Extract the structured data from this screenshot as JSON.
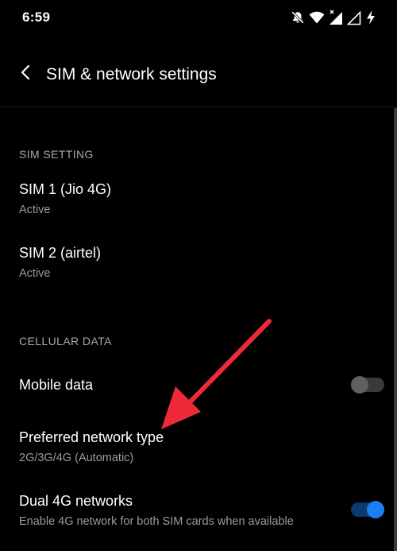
{
  "status_bar": {
    "time": "6:59",
    "icons": [
      "mute-bell-icon",
      "wifi-icon",
      "cell-signal-no-data-icon",
      "cell-signal-icon",
      "battery-charging-icon"
    ]
  },
  "header": {
    "back_icon": "back-chevron-icon",
    "title": "SIM & network settings"
  },
  "sections": {
    "sim": {
      "header": "SIM SETTING",
      "items": [
        {
          "title": "SIM 1  (Jio 4G)",
          "subtitle": "Active"
        },
        {
          "title": "SIM 2  (airtel)",
          "subtitle": "Active"
        }
      ]
    },
    "cellular": {
      "header": "CELLULAR DATA",
      "mobile_data": {
        "title": "Mobile data",
        "enabled": false
      },
      "preferred_network": {
        "title": "Preferred network type",
        "subtitle": "2G/3G/4G (Automatic)"
      },
      "dual_4g": {
        "title": "Dual 4G networks",
        "subtitle": "Enable 4G network for both SIM cards when available",
        "enabled": true
      }
    }
  },
  "colors": {
    "background": "#000000",
    "primary_text": "#ffffff",
    "secondary_text": "#9b9b9b",
    "toggle_on": "#1b7ef2",
    "toggle_off": "#5f5f5f",
    "annotation_arrow": "#ee2a3a"
  }
}
